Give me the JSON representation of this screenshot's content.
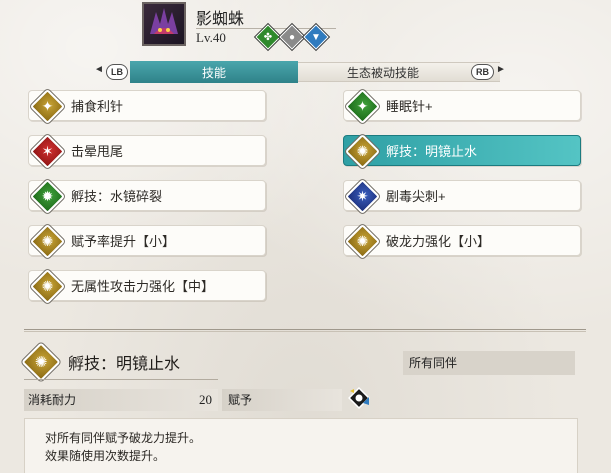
{
  "monster": {
    "name": "影蜘蛛",
    "level": "Lv.40",
    "element_icons": [
      {
        "name": "leaf-element-icon",
        "color": "#2f8a2c",
        "glyph": "✤"
      },
      {
        "name": "rock-element-icon",
        "color": "#8a8a8a",
        "glyph": "●"
      },
      {
        "name": "water-element-icon",
        "color": "#2f7bbf",
        "glyph": "💧"
      }
    ]
  },
  "tabs": {
    "left_button": "LB",
    "right_button": "RB",
    "left_arrow": "◄",
    "right_arrow": "►",
    "active": "技能",
    "inactive": "生态被动技能"
  },
  "skills": [
    {
      "label": "捕食利针",
      "color": "gold",
      "selected": false
    },
    {
      "label": "睡眠针+",
      "color": "green",
      "selected": false
    },
    {
      "label": "击晕甩尾",
      "color": "red",
      "selected": false
    },
    {
      "label": "孵技：明镜止水",
      "color": "gold",
      "selected": true
    },
    {
      "label": "孵技：水镜碎裂",
      "color": "green",
      "selected": false
    },
    {
      "label": "剧毒尖刺+",
      "color": "blue",
      "selected": false
    },
    {
      "label": "赋予率提升【小】",
      "color": "gold",
      "selected": false
    },
    {
      "label": "破龙力强化【小】",
      "color": "gold",
      "selected": false
    },
    {
      "label": "无属性攻击力强化【中】",
      "color": "gold",
      "selected": false
    }
  ],
  "detail": {
    "title": "孵技：明镜止水",
    "target": "所有同伴",
    "cost_label": "消耗耐力",
    "cost_value": "20",
    "grant_label": "赋予",
    "description": [
      "对所有同伴赋予破龙力提升。",
      "效果随使用次数提升。"
    ]
  }
}
